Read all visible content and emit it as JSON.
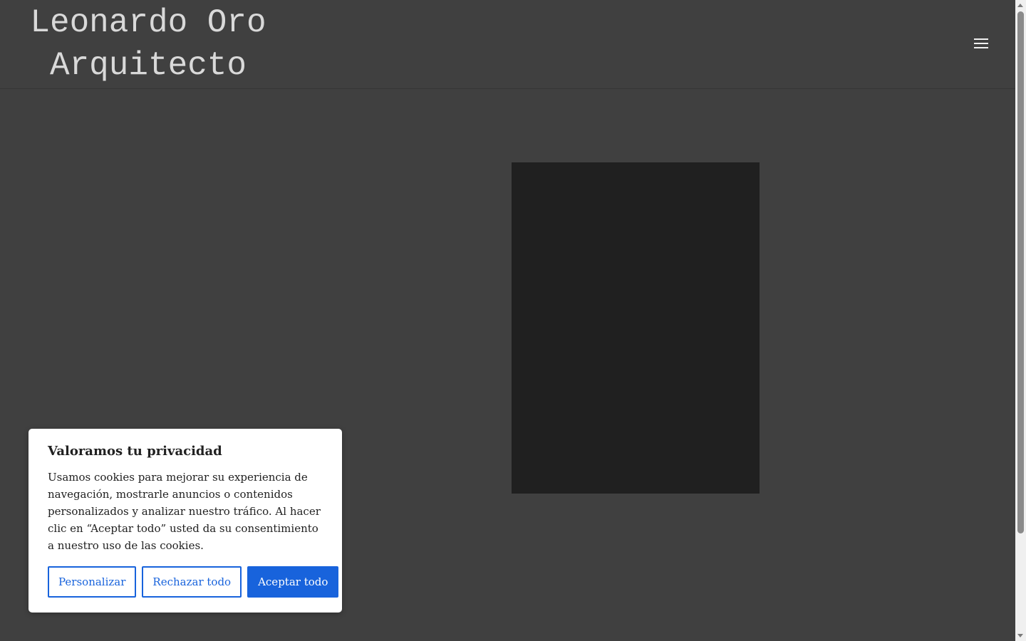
{
  "header": {
    "title_line1": "Leonardo Oro",
    "title_line2": "Arquitecto",
    "menu_icon": "hamburger-menu-icon"
  },
  "hero": {
    "image": "dark-placeholder-image"
  },
  "cookie_banner": {
    "title": "Valoramos tu privacidad",
    "text": "Usamos cookies para mejorar su experiencia de navegación, mostrarle anuncios o contenidos personalizados y analizar nuestro tráfico. Al hacer clic en “Aceptar todo” usted da su consentimiento a nuestro uso de las cookies.",
    "customize_label": "Personalizar",
    "reject_label": "Rechazar todo",
    "accept_label": "Aceptar todo"
  },
  "colors": {
    "background": "#404040",
    "accent": "#1863dc",
    "image": "#202020"
  }
}
